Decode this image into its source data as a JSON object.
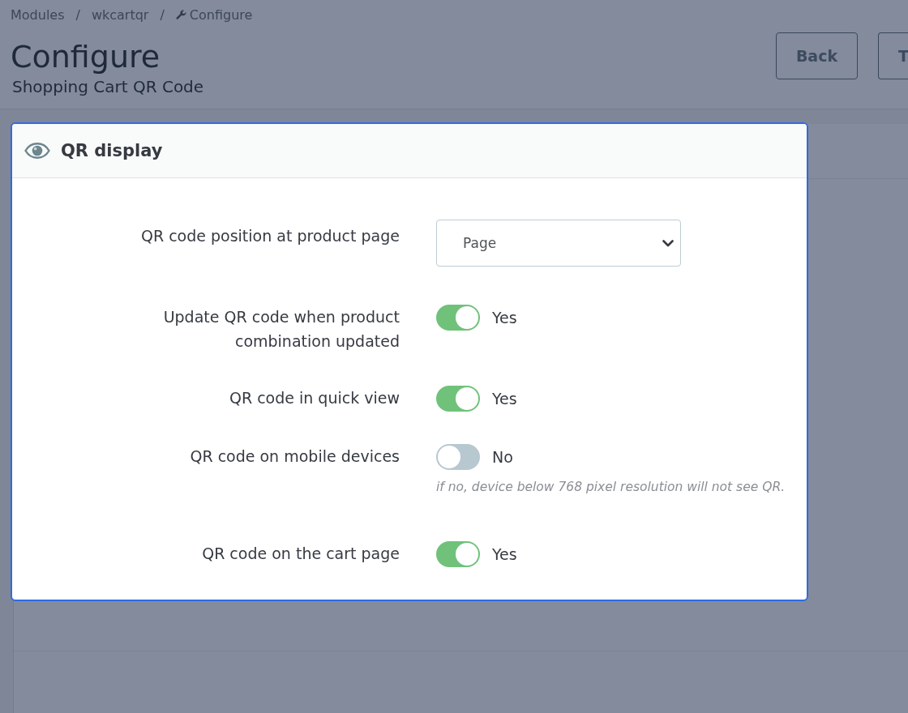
{
  "breadcrumb": [
    {
      "label": "Modules",
      "separator": "/"
    },
    {
      "label": "wkcartqr",
      "separator": "/"
    },
    {
      "label": "Configure"
    }
  ],
  "page_header": {
    "title": "Configure",
    "subtitle": "Shopping Cart QR Code",
    "buttons": [
      {
        "label": "Back"
      },
      {
        "label": "T"
      }
    ]
  },
  "panel": {
    "title": "QR display",
    "fields": [
      {
        "kind": "select",
        "label": "QR code position at product page",
        "value": "Page"
      },
      {
        "kind": "switch",
        "label": "Update QR code when product combination updated",
        "on": true,
        "state_text": "Yes"
      },
      {
        "kind": "switch",
        "label": "QR code in quick view",
        "on": true,
        "state_text": "Yes"
      },
      {
        "kind": "switch",
        "label": "QR code on mobile devices",
        "on": false,
        "state_text": "No",
        "help": "if no, device below 768 pixel resolution will not see QR."
      },
      {
        "kind": "switch",
        "label": "QR code on the cart page",
        "on": true,
        "state_text": "Yes"
      }
    ]
  }
}
